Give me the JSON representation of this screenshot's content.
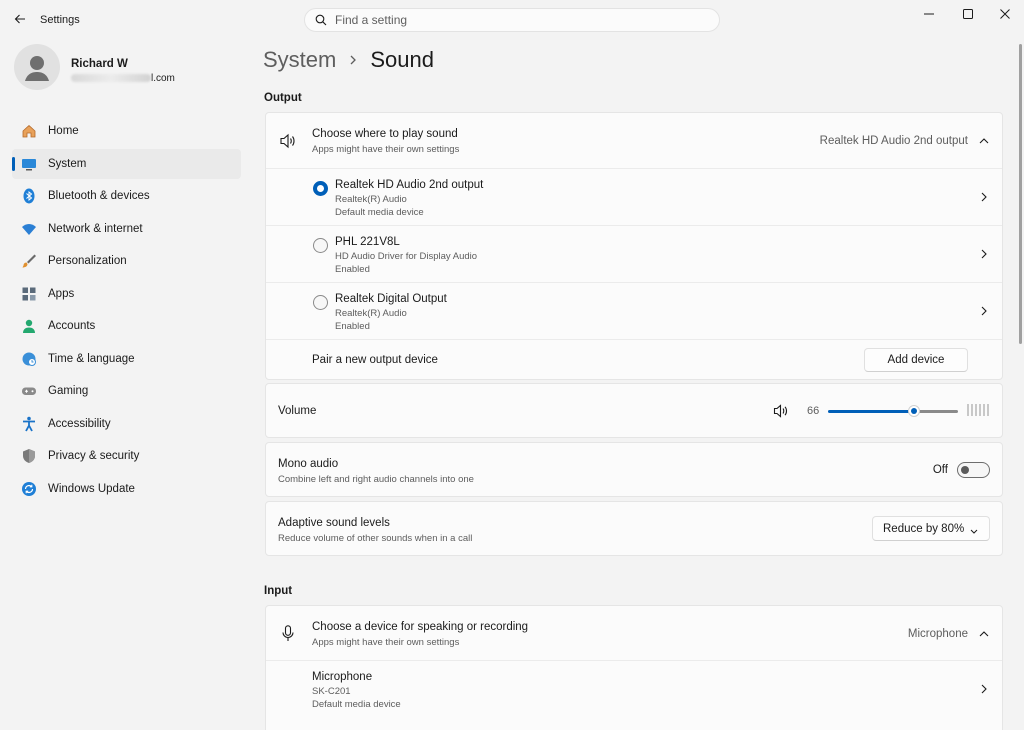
{
  "window": {
    "app_title": "Settings",
    "controls": [
      "minimize",
      "maximize",
      "close"
    ]
  },
  "search": {
    "placeholder": "Find a setting",
    "value": ""
  },
  "profile": {
    "name": "Richard W",
    "email_visible_suffix": "l.com"
  },
  "nav": {
    "items": [
      {
        "label": "Home",
        "icon": "home-icon",
        "active": false
      },
      {
        "label": "System",
        "icon": "system-icon",
        "active": true
      },
      {
        "label": "Bluetooth & devices",
        "icon": "bluetooth-icon",
        "active": false
      },
      {
        "label": "Network & internet",
        "icon": "network-icon",
        "active": false
      },
      {
        "label": "Personalization",
        "icon": "brush-icon",
        "active": false
      },
      {
        "label": "Apps",
        "icon": "apps-icon",
        "active": false
      },
      {
        "label": "Accounts",
        "icon": "accounts-icon",
        "active": false
      },
      {
        "label": "Time & language",
        "icon": "globe-icon",
        "active": false
      },
      {
        "label": "Gaming",
        "icon": "gamepad-icon",
        "active": false
      },
      {
        "label": "Accessibility",
        "icon": "accessibility-icon",
        "active": false
      },
      {
        "label": "Privacy & security",
        "icon": "shield-icon",
        "active": false
      },
      {
        "label": "Windows Update",
        "icon": "update-icon",
        "active": false
      }
    ]
  },
  "breadcrumb": {
    "parent": "System",
    "current": "Sound"
  },
  "output": {
    "section_title": "Output",
    "choose": {
      "title": "Choose where to play sound",
      "subtitle": "Apps might have their own settings",
      "selected": "Realtek HD Audio 2nd output"
    },
    "devices": [
      {
        "name": "Realtek HD Audio 2nd output",
        "driver": "Realtek(R) Audio",
        "status": "Default media device",
        "selected": true
      },
      {
        "name": "PHL 221V8L",
        "driver": "HD Audio Driver for Display Audio",
        "status": "Enabled",
        "selected": false
      },
      {
        "name": "Realtek Digital Output",
        "driver": "Realtek(R) Audio",
        "status": "Enabled",
        "selected": false
      }
    ],
    "pair": {
      "label": "Pair a new output device",
      "button": "Add device"
    },
    "volume": {
      "label": "Volume",
      "value": "66",
      "level": 66
    },
    "mono": {
      "title": "Mono audio",
      "subtitle": "Combine left and right audio channels into one",
      "state": "Off"
    },
    "adaptive": {
      "title": "Adaptive sound levels",
      "subtitle": "Reduce volume of other sounds when in a call",
      "value": "Reduce by 80%"
    }
  },
  "input": {
    "section_title": "Input",
    "choose": {
      "title": "Choose a device for speaking or recording",
      "subtitle": "Apps might have their own settings",
      "selected": "Microphone"
    },
    "devices": [
      {
        "name": "Microphone",
        "driver": "SK-C201",
        "status": "Default media device"
      }
    ]
  },
  "colors": {
    "accent": "#005fb8",
    "background": "#f3f3f3",
    "card": "#fbfbfb"
  }
}
